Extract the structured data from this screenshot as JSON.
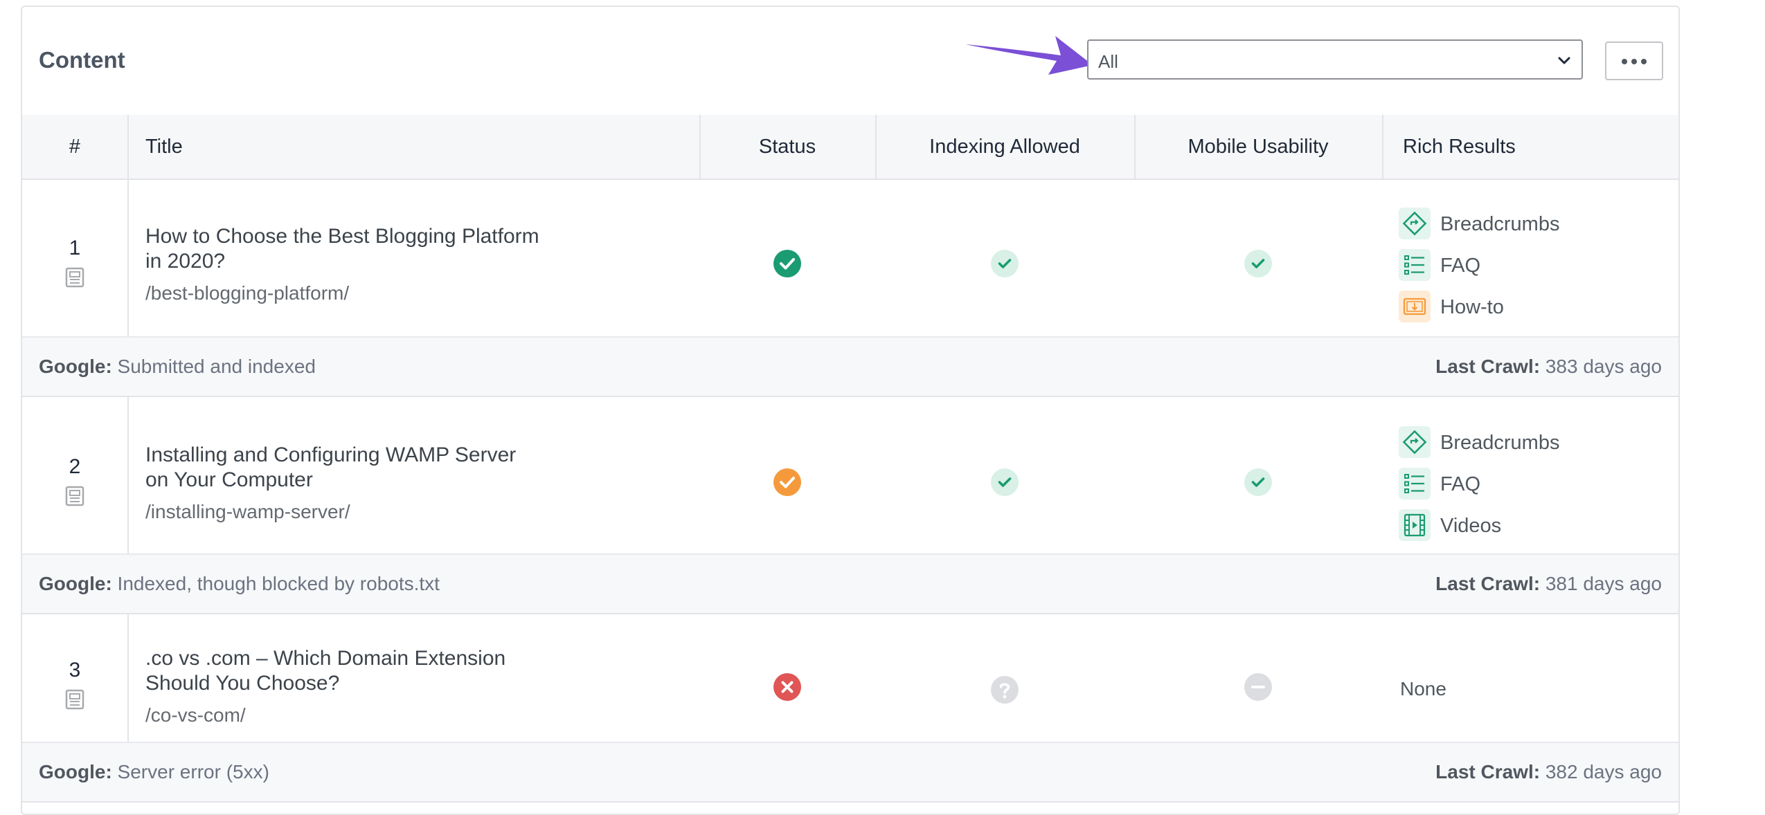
{
  "header": {
    "title": "Content",
    "filter": {
      "value": "All"
    }
  },
  "columns": [
    "#",
    "Title",
    "Status",
    "Indexing Allowed",
    "Mobile Usability",
    "Rich Results"
  ],
  "labels": {
    "google": "Google:",
    "last_crawl": "Last Crawl:"
  },
  "rows": [
    {
      "num": "1",
      "title_line1": "How to Choose the Best Blogging Platform",
      "title_line2": "in 2020?",
      "slug": "/best-blogging-platform/",
      "status": "success",
      "indexing": "allowed",
      "mobile": "usable",
      "rich_results": [
        "Breadcrumbs",
        "FAQ",
        "How-to"
      ],
      "google_status": "Submitted and indexed",
      "last_crawl": "383 days ago"
    },
    {
      "num": "2",
      "title_line1": "Installing and Configuring WAMP Server",
      "title_line2": "on Your Computer",
      "slug": "/installing-wamp-server/",
      "status": "warning",
      "indexing": "allowed",
      "mobile": "usable",
      "rich_results": [
        "Breadcrumbs",
        "FAQ",
        "Videos"
      ],
      "google_status": "Indexed, though blocked by robots.txt",
      "last_crawl": "381 days ago"
    },
    {
      "num": "3",
      "title_line1": ".co vs .com – Which Domain Extension",
      "title_line2": "Should You Choose?",
      "slug": "/co-vs-com/",
      "status": "error",
      "indexing": "unknown",
      "mobile": "unavailable",
      "rich_results_none": "None",
      "google_status": "Server error (5xx)",
      "last_crawl": "382 days ago"
    }
  ],
  "colors": {
    "success": "#1a9b72",
    "warning": "#f59a3c",
    "error": "#e05555",
    "check_light_bg": "#d8f0e6",
    "check_light_fg": "#1a9b72",
    "gray_icon": "#dcdde1",
    "arrow": "#7b4fd6"
  }
}
